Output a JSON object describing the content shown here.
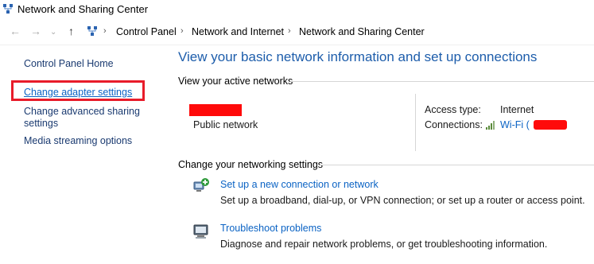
{
  "window": {
    "title": "Network and Sharing Center",
    "icon": "network-center-icon"
  },
  "nav": {
    "back_icon": "arrow-left-icon",
    "forward_icon": "arrow-right-icon",
    "dropdown_icon": "chevron-down-icon",
    "up_icon": "arrow-up-icon",
    "breadcrumbs": [
      "Control Panel",
      "Network and Internet",
      "Network and Sharing Center"
    ]
  },
  "sidebar": {
    "items": [
      {
        "label": "Control Panel Home"
      },
      {
        "label": "Change adapter settings",
        "highlighted": true,
        "highlight_color": "#e81c2a"
      },
      {
        "label_line1": "Change advanced sharing",
        "label_line2": "settings"
      },
      {
        "label": "Media streaming options"
      }
    ]
  },
  "main": {
    "heading": "View your basic network information and set up connections",
    "active_networks": {
      "section_label": "View your active networks",
      "network_type": "Public network",
      "access_type_label": "Access type:",
      "access_type_value": "Internet",
      "connections_label": "Connections:",
      "connection_icon": "wifi-signal-icon",
      "connection_value": "Wi-Fi ("
    },
    "settings": {
      "section_label": "Change your networking settings",
      "items": [
        {
          "icon": "new-connection-icon",
          "title": "Set up a new connection or network",
          "description": "Set up a broadband, dial-up, or VPN connection; or set up a router or access point."
        },
        {
          "icon": "troubleshoot-icon",
          "title": "Troubleshoot problems",
          "description": "Diagnose and repair network problems, or get troubleshooting information."
        }
      ]
    }
  },
  "colors": {
    "link": "#0b63c4",
    "heading": "#1d5dab",
    "redaction": "#ff0a0a"
  }
}
